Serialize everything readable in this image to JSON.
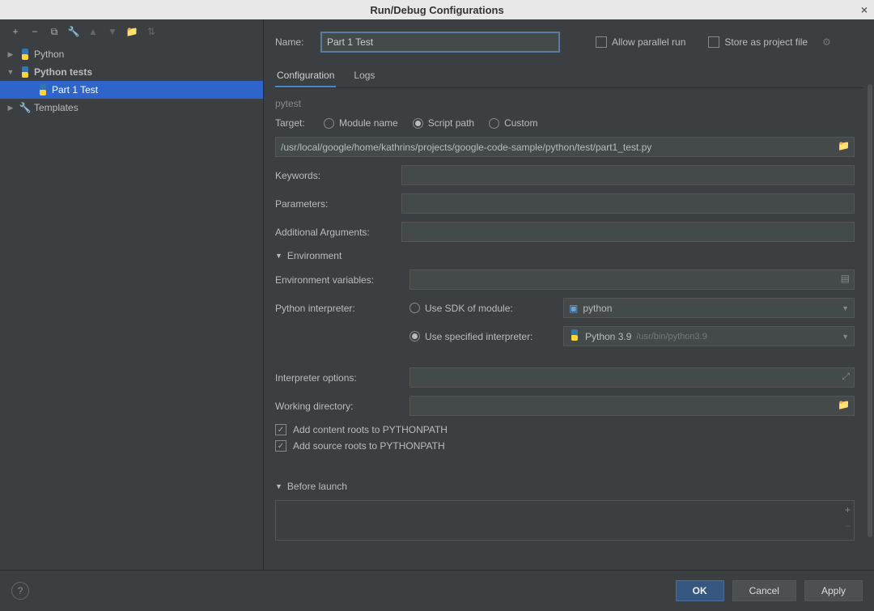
{
  "title": "Run/Debug Configurations",
  "tree": {
    "python": "Python",
    "pytests": "Python tests",
    "part1": "Part 1 Test",
    "templates": "Templates"
  },
  "name": {
    "label": "Name:",
    "value": "Part 1 Test",
    "allowParallel": "Allow parallel run",
    "storeAsFile": "Store as project file"
  },
  "tabs": {
    "configuration": "Configuration",
    "logs": "Logs"
  },
  "form": {
    "sectionPytest": "pytest",
    "targetLabel": "Target:",
    "targetModule": "Module name",
    "targetScript": "Script path",
    "targetCustom": "Custom",
    "scriptPath": "/usr/local/google/home/kathrins/projects/google-code-sample/python/test/part1_test.py",
    "keywords": "Keywords:",
    "parameters": "Parameters:",
    "addlArgs": "Additional Arguments:",
    "envHeader": "Environment",
    "envVars": "Environment variables:",
    "pyInterp": "Python interpreter:",
    "useSdk": "Use SDK of module:",
    "sdkModule": "python",
    "useSpecified": "Use specified interpreter:",
    "specInterpreter": "Python 3.9",
    "specInterpreterPath": "/usr/bin/python3.9",
    "interpOptions": "Interpreter options:",
    "workingDir": "Working directory:",
    "addContent": "Add content roots to PYTHONPATH",
    "addSource": "Add source roots to PYTHONPATH",
    "beforeLaunch": "Before launch"
  },
  "footer": {
    "ok": "OK",
    "cancel": "Cancel",
    "apply": "Apply"
  }
}
